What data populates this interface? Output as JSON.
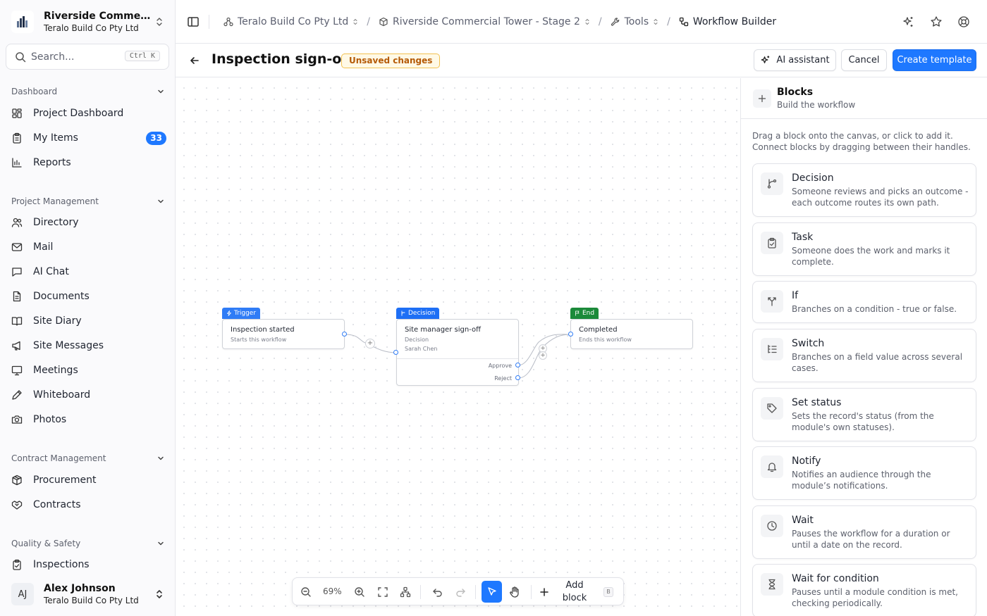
{
  "sidebar": {
    "project_name": "Riverside Commercial Tower - Stage 2",
    "project_org": "Teralo Build Co Pty Ltd",
    "search": {
      "placeholder": "Search...",
      "shortcut": "Ctrl K"
    },
    "sections": [
      {
        "title": "Dashboard",
        "items": [
          {
            "label": "Project Dashboard",
            "icon": "grid-icon"
          },
          {
            "label": "My Items",
            "icon": "clipboard-list-icon",
            "badge": "33"
          },
          {
            "label": "Reports",
            "icon": "bar-chart-icon"
          }
        ]
      },
      {
        "title": "Project Management",
        "items": [
          {
            "label": "Directory",
            "icon": "users-icon"
          },
          {
            "label": "Mail",
            "icon": "mail-icon"
          },
          {
            "label": "AI Chat",
            "icon": "chat-icon"
          },
          {
            "label": "Documents",
            "icon": "document-icon"
          },
          {
            "label": "Site Diary",
            "icon": "book-icon"
          },
          {
            "label": "Site Messages",
            "icon": "megaphone-icon"
          },
          {
            "label": "Meetings",
            "icon": "presentation-icon"
          },
          {
            "label": "Whiteboard",
            "icon": "pen-icon"
          },
          {
            "label": "Photos",
            "icon": "camera-icon"
          }
        ]
      },
      {
        "title": "Contract Management",
        "items": [
          {
            "label": "Procurement",
            "icon": "package-icon"
          },
          {
            "label": "Contracts",
            "icon": "handshake-icon"
          }
        ]
      },
      {
        "title": "Quality & Safety",
        "items": [
          {
            "label": "Inspections",
            "icon": "clipboard-check-icon"
          }
        ]
      }
    ],
    "user": {
      "initials": "AJ",
      "name": "Alex Johnson",
      "org": "Teralo Build Co Pty Ltd"
    }
  },
  "topbar": {
    "breadcrumbs": [
      {
        "label": "Teralo Build Co Pty Ltd",
        "icon": "network-icon",
        "dropdown": true
      },
      {
        "label": "Riverside Commercial Tower - Stage 2",
        "icon": "box-icon",
        "dropdown": true
      },
      {
        "label": "Tools",
        "icon": "wrench-icon",
        "dropdown": true
      },
      {
        "label": "Workflow Builder",
        "icon": "workflow-icon",
        "dropdown": false
      }
    ]
  },
  "header": {
    "title": "Inspection sign-off",
    "status_badge": "Unsaved changes",
    "ai_assistant_label": "AI assistant",
    "cancel_label": "Cancel",
    "create_label": "Create template"
  },
  "canvas": {
    "nodes": [
      {
        "tag": "Trigger",
        "title": "Inspection started",
        "subtitle": "Starts this workflow",
        "color": "#2f7cf6"
      },
      {
        "tag": "Decision",
        "title": "Site manager sign-off",
        "subtitle": "Decision",
        "assignee": "Sarah Chen",
        "ports": [
          "Approve",
          "Reject"
        ],
        "color": "#1e6ff5"
      },
      {
        "tag": "End",
        "title": "Completed",
        "subtitle": "Ends this workflow",
        "color": "#1b8a3a"
      }
    ],
    "toolbar": {
      "zoom": "69%",
      "add_block_label": "Add block",
      "add_block_shortcut": "B"
    }
  },
  "panel": {
    "title": "Blocks",
    "subtitle": "Build the workflow",
    "help": "Drag a block onto the canvas, or click to add it. Connect blocks by dragging between their handles.",
    "blocks": [
      {
        "title": "Decision",
        "desc": "Someone reviews and picks an outcome - each outcome routes its own path.",
        "icon": "branch-icon"
      },
      {
        "title": "Task",
        "desc": "Someone does the work and marks it complete.",
        "icon": "clipboard-check-icon"
      },
      {
        "title": "If",
        "desc": "Branches on a condition - true or false.",
        "icon": "split-icon"
      },
      {
        "title": "Switch",
        "desc": "Branches on a field value across several cases.",
        "icon": "list-tree-icon"
      },
      {
        "title": "Set status",
        "desc": "Sets the record's status (from the module's own statuses).",
        "icon": "tag-icon"
      },
      {
        "title": "Notify",
        "desc": "Notifies an audience through the module’s notifications.",
        "icon": "bell-icon"
      },
      {
        "title": "Wait",
        "desc": "Pauses the workflow for a duration or until a date on the record.",
        "icon": "clock-icon"
      },
      {
        "title": "Wait for condition",
        "desc": "Pauses until a module condition is met, checking periodically.",
        "icon": "hourglass-icon"
      }
    ]
  },
  "colors": {
    "accent": "#1e78ff",
    "warning_text": "#b55a06",
    "warning_border": "#f2c14f",
    "end_green": "#1b8a3a"
  }
}
